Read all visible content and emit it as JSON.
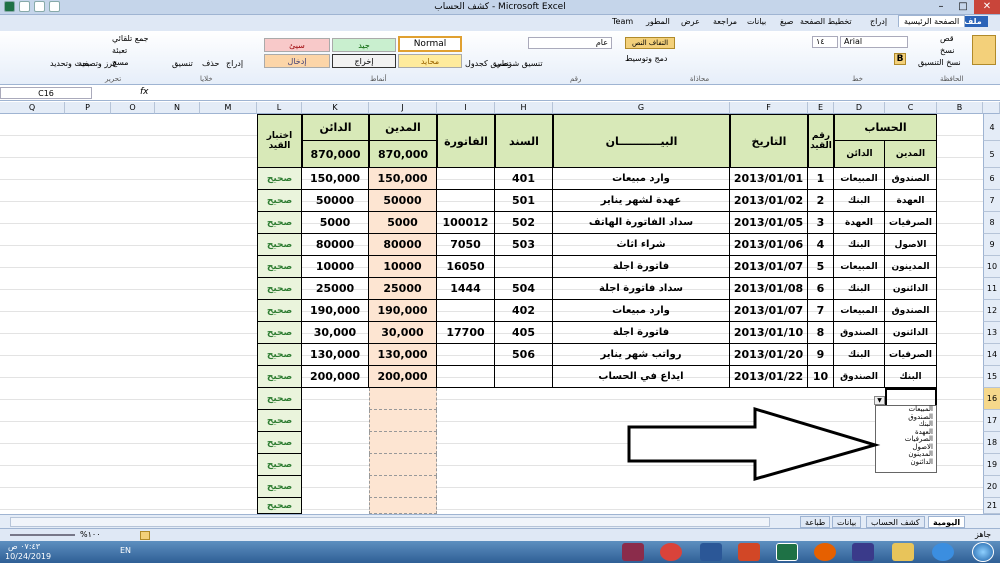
{
  "window": {
    "title": "كشف الحساب - Microsoft Excel"
  },
  "ribbon": {
    "tabs": [
      "ملف",
      "الصفحة الرئيسية",
      "إدراج",
      "تخطيط الصفحة",
      "صيغ",
      "بيانات",
      "مراجعة",
      "عرض",
      "المطور",
      "Team"
    ],
    "clipboard": {
      "cut": "قص",
      "copy": "نسخ",
      "paste_fmt": "نسخ التنسيق",
      "group": "الحافظة"
    },
    "font": {
      "name": "Arial",
      "size": "١٤",
      "group": "خط"
    },
    "alignment": {
      "wrap": "التفاف النص",
      "merge": "دمج وتوسيط",
      "group": "محاذاة"
    },
    "number": {
      "format": "عام",
      "group": "رقم"
    },
    "styles": {
      "cond": "تنسيق شرطي",
      "table": "تنسيق كجدول",
      "bad": "سيئ",
      "good": "جيد",
      "normal": "Normal",
      "neutral": "محايد",
      "output": "إخراج",
      "input": "إدخال",
      "group": "أنماط"
    },
    "cells": {
      "insert": "إدراج",
      "delete": "حذف",
      "format": "تنسيق",
      "group": "خلايا"
    },
    "editing": {
      "autosum": "جمع تلقائي",
      "fill": "تعبئة",
      "clear": "مسح",
      "sort": "فرز وتصفية",
      "find": "بحث وتحديد",
      "group": "تحرير"
    }
  },
  "formula_bar": {
    "name_box": "C16",
    "formula": ""
  },
  "columns": [
    "Q",
    "P",
    "O",
    "N",
    "M",
    "L",
    "K",
    "J",
    "I",
    "H",
    "G",
    "F",
    "E",
    "D",
    "C",
    "B"
  ],
  "rows": [
    "4",
    "5",
    "6",
    "7",
    "8",
    "9",
    "10",
    "11",
    "12",
    "13",
    "14",
    "15",
    "16",
    "17",
    "18",
    "19",
    "20",
    "21"
  ],
  "table": {
    "headers": {
      "account": "الحساب",
      "debit_acct": "المدين",
      "credit_acct": "الدائن",
      "entry_no": "رقم القيد",
      "date": "التاريخ",
      "description": "البيـــــــــــان",
      "doc": "السند",
      "invoice": "الفاتورة",
      "debit": "المدين",
      "credit": "الدائن",
      "check": "اختبار القيد"
    },
    "totals": {
      "debit": "870,000",
      "credit": "870,000"
    },
    "rows": [
      {
        "dr": "الصندوق",
        "cr": "المبيعات",
        "no": "1",
        "date": "2013/01/01",
        "desc": "وارد مبيعات",
        "doc": "401",
        "inv": "",
        "debit": "150,000",
        "credit": "150,000",
        "check": "صحيح"
      },
      {
        "dr": "العهدة",
        "cr": "البنك",
        "no": "2",
        "date": "2013/01/02",
        "desc": "عهدة لشهر يناير",
        "doc": "501",
        "inv": "",
        "debit": "50000",
        "credit": "50000",
        "check": "صحيح"
      },
      {
        "dr": "الصرفيات",
        "cr": "العهدة",
        "no": "3",
        "date": "2013/01/05",
        "desc": "سداد الفاتورة الهاتف",
        "doc": "502",
        "inv": "100012",
        "debit": "5000",
        "credit": "5000",
        "check": "صحيح"
      },
      {
        "dr": "الاصول",
        "cr": "البنك",
        "no": "4",
        "date": "2013/01/06",
        "desc": "شراء اثاث",
        "doc": "503",
        "inv": "7050",
        "debit": "80000",
        "credit": "80000",
        "check": "صحيح"
      },
      {
        "dr": "المدينون",
        "cr": "المبيعات",
        "no": "5",
        "date": "2013/01/07",
        "desc": "فاتورة اجلة",
        "doc": "",
        "inv": "16050",
        "debit": "10000",
        "credit": "10000",
        "check": "صحيح"
      },
      {
        "dr": "الدائنون",
        "cr": "البنك",
        "no": "6",
        "date": "2013/01/08",
        "desc": "سداد فاتورة اجلة",
        "doc": "504",
        "inv": "1444",
        "debit": "25000",
        "credit": "25000",
        "check": "صحيح"
      },
      {
        "dr": "الصندوق",
        "cr": "المبيعات",
        "no": "7",
        "date": "2013/01/07",
        "desc": "وارد مبيعات",
        "doc": "402",
        "inv": "",
        "debit": "190,000",
        "credit": "190,000",
        "check": "صحيح"
      },
      {
        "dr": "الدائنون",
        "cr": "الصندوق",
        "no": "8",
        "date": "2013/01/10",
        "desc": "فاتورة اجلة",
        "doc": "405",
        "inv": "17700",
        "debit": "30,000",
        "credit": "30,000",
        "check": "صحيح"
      },
      {
        "dr": "الصرفيات",
        "cr": "البنك",
        "no": "9",
        "date": "2013/01/20",
        "desc": "رواتب شهر يناير",
        "doc": "506",
        "inv": "",
        "debit": "130,000",
        "credit": "130,000",
        "check": "صحيح"
      },
      {
        "dr": "البنك",
        "cr": "الصندوق",
        "no": "10",
        "date": "2013/01/22",
        "desc": "ايداع في الحساب",
        "doc": "",
        "inv": "",
        "debit": "200,000",
        "credit": "200,000",
        "check": "صحيح"
      }
    ],
    "empty_check": "صحيح"
  },
  "dropdown_options": [
    "المبيعات",
    "الصندوق",
    "البنك",
    "العهدة",
    "الصرفيات",
    "الاصول",
    "المدينون",
    "الدائنون"
  ],
  "sheets": [
    "اليومية",
    "كشف الحساب",
    "بيانات",
    "طباعة"
  ],
  "status": {
    "mode": "جاهز",
    "zoom": "%١٠٠"
  },
  "taskbar": {
    "lang": "EN",
    "time": "٠٧:٤٣ ص",
    "date": "10/24/2019"
  }
}
